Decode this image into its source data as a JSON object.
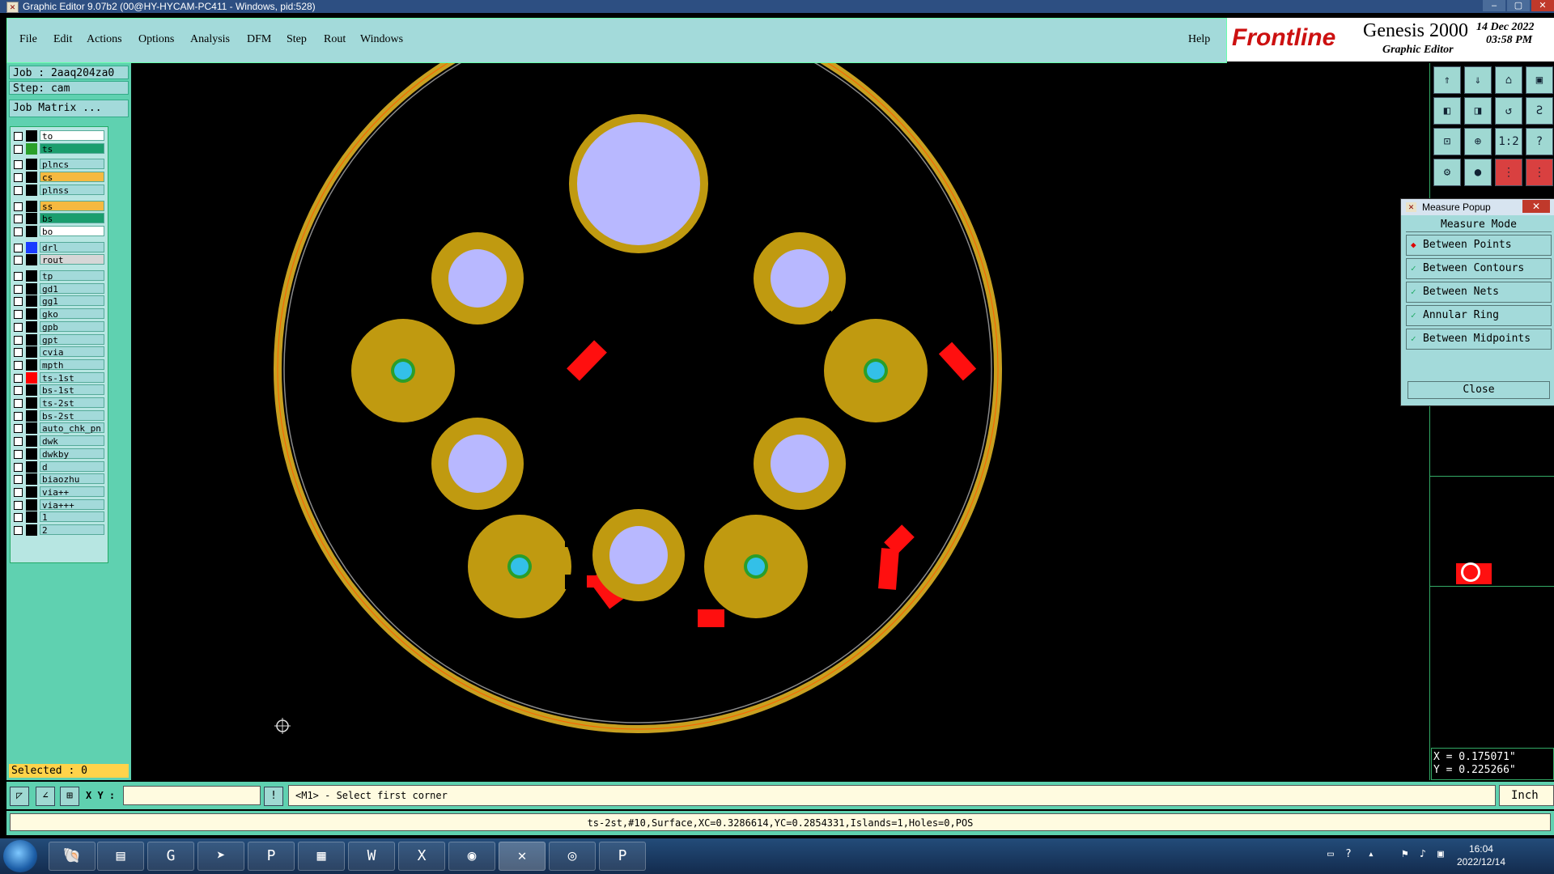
{
  "window": {
    "title": "Graphic Editor 9.07b2 (00@HY-HYCAM-PC411 - Windows, pid:528)"
  },
  "menu": [
    "File",
    "Edit",
    "Actions",
    "Options",
    "Analysis",
    "DFM",
    "Step",
    "Rout",
    "Windows"
  ],
  "help": "Help",
  "brand": {
    "logo": "Frontline",
    "product": "Genesis 2000",
    "subtitle": "Graphic Editor",
    "date": "14 Dec 2022",
    "time": "03:58 PM"
  },
  "job": {
    "job": "Job : 2aaq204za0",
    "step": "Step: cam",
    "matrix": "Job Matrix ..."
  },
  "layers": [
    {
      "name": "to",
      "color": "#000000",
      "bg": "#ffffff"
    },
    {
      "name": "ts",
      "color": "#2aa02a",
      "bg": "#1a9e6e"
    },
    {
      "name": "plncs",
      "color": "#000000",
      "bg": "#a3dada"
    },
    {
      "name": "cs",
      "color": "#000000",
      "bg": "#f5b940"
    },
    {
      "name": "plnss",
      "color": "#000000",
      "bg": "#a3dada"
    },
    {
      "name": "ss",
      "color": "#000000",
      "bg": "#f5b940"
    },
    {
      "name": "bs",
      "color": "#000000",
      "bg": "#1a9e6e"
    },
    {
      "name": "bo",
      "color": "#000000",
      "bg": "#ffffff"
    },
    {
      "name": "drl",
      "color": "#1a3cff",
      "bg": "#a3dada"
    },
    {
      "name": "rout",
      "color": "#000000",
      "bg": "#d6d6d6"
    },
    {
      "name": "tp",
      "color": "#000000",
      "bg": "#a3dada"
    },
    {
      "name": "gd1",
      "color": "#000000",
      "bg": "#a3dada"
    },
    {
      "name": "gg1",
      "color": "#000000",
      "bg": "#a3dada"
    },
    {
      "name": "gko",
      "color": "#000000",
      "bg": "#a3dada"
    },
    {
      "name": "gpb",
      "color": "#000000",
      "bg": "#a3dada"
    },
    {
      "name": "gpt",
      "color": "#000000",
      "bg": "#a3dada"
    },
    {
      "name": "cvia",
      "color": "#000000",
      "bg": "#a3dada"
    },
    {
      "name": "mpth",
      "color": "#000000",
      "bg": "#a3dada"
    },
    {
      "name": "ts-1st",
      "color": "#ff0000",
      "bg": "#a3dada"
    },
    {
      "name": "bs-1st",
      "color": "#000000",
      "bg": "#a3dada"
    },
    {
      "name": "ts-2st",
      "color": "#000000",
      "bg": "#a3dada"
    },
    {
      "name": "bs-2st",
      "color": "#000000",
      "bg": "#a3dada"
    },
    {
      "name": "auto_chk_pn",
      "color": "#000000",
      "bg": "#a3dada"
    },
    {
      "name": "dwk",
      "color": "#000000",
      "bg": "#a3dada"
    },
    {
      "name": "dwkby",
      "color": "#000000",
      "bg": "#a3dada"
    },
    {
      "name": "d",
      "color": "#000000",
      "bg": "#a3dada"
    },
    {
      "name": "biaozhu",
      "color": "#000000",
      "bg": "#a3dada"
    },
    {
      "name": "via++",
      "color": "#000000",
      "bg": "#a3dada"
    },
    {
      "name": "via+++",
      "color": "#000000",
      "bg": "#a3dada"
    },
    {
      "name": "1",
      "color": "#000000",
      "bg": "#a3dada"
    },
    {
      "name": "2",
      "color": "#000000",
      "bg": "#a3dada"
    }
  ],
  "selected": "Selected : 0",
  "measure_popup": {
    "title": "Measure Popup",
    "mode_label": "Measure Mode",
    "options": [
      "Between Points",
      "Between Contours",
      "Between Nets",
      "Annular Ring",
      "Between Midpoints"
    ],
    "selected_option": "Between Points",
    "close": "Close"
  },
  "coords": {
    "x": "X = 0.175071\"",
    "y": "Y = 0.225266\""
  },
  "command": {
    "xy_label": "X Y :",
    "prompt": "<M1> - Select first corner",
    "unit": "Inch"
  },
  "status": "ts-2st,#10,Surface,XC=0.3286614,YC=0.2854331,Islands=1,Holes=0,POS",
  "clock": {
    "time": "16:04",
    "date": "2022/12/14"
  },
  "colors": {
    "pad": "#c09a10",
    "hole": "#b8b8ff",
    "via": "#33c0e8",
    "trace": "#ff0f0f",
    "outline": "#c8a020"
  }
}
